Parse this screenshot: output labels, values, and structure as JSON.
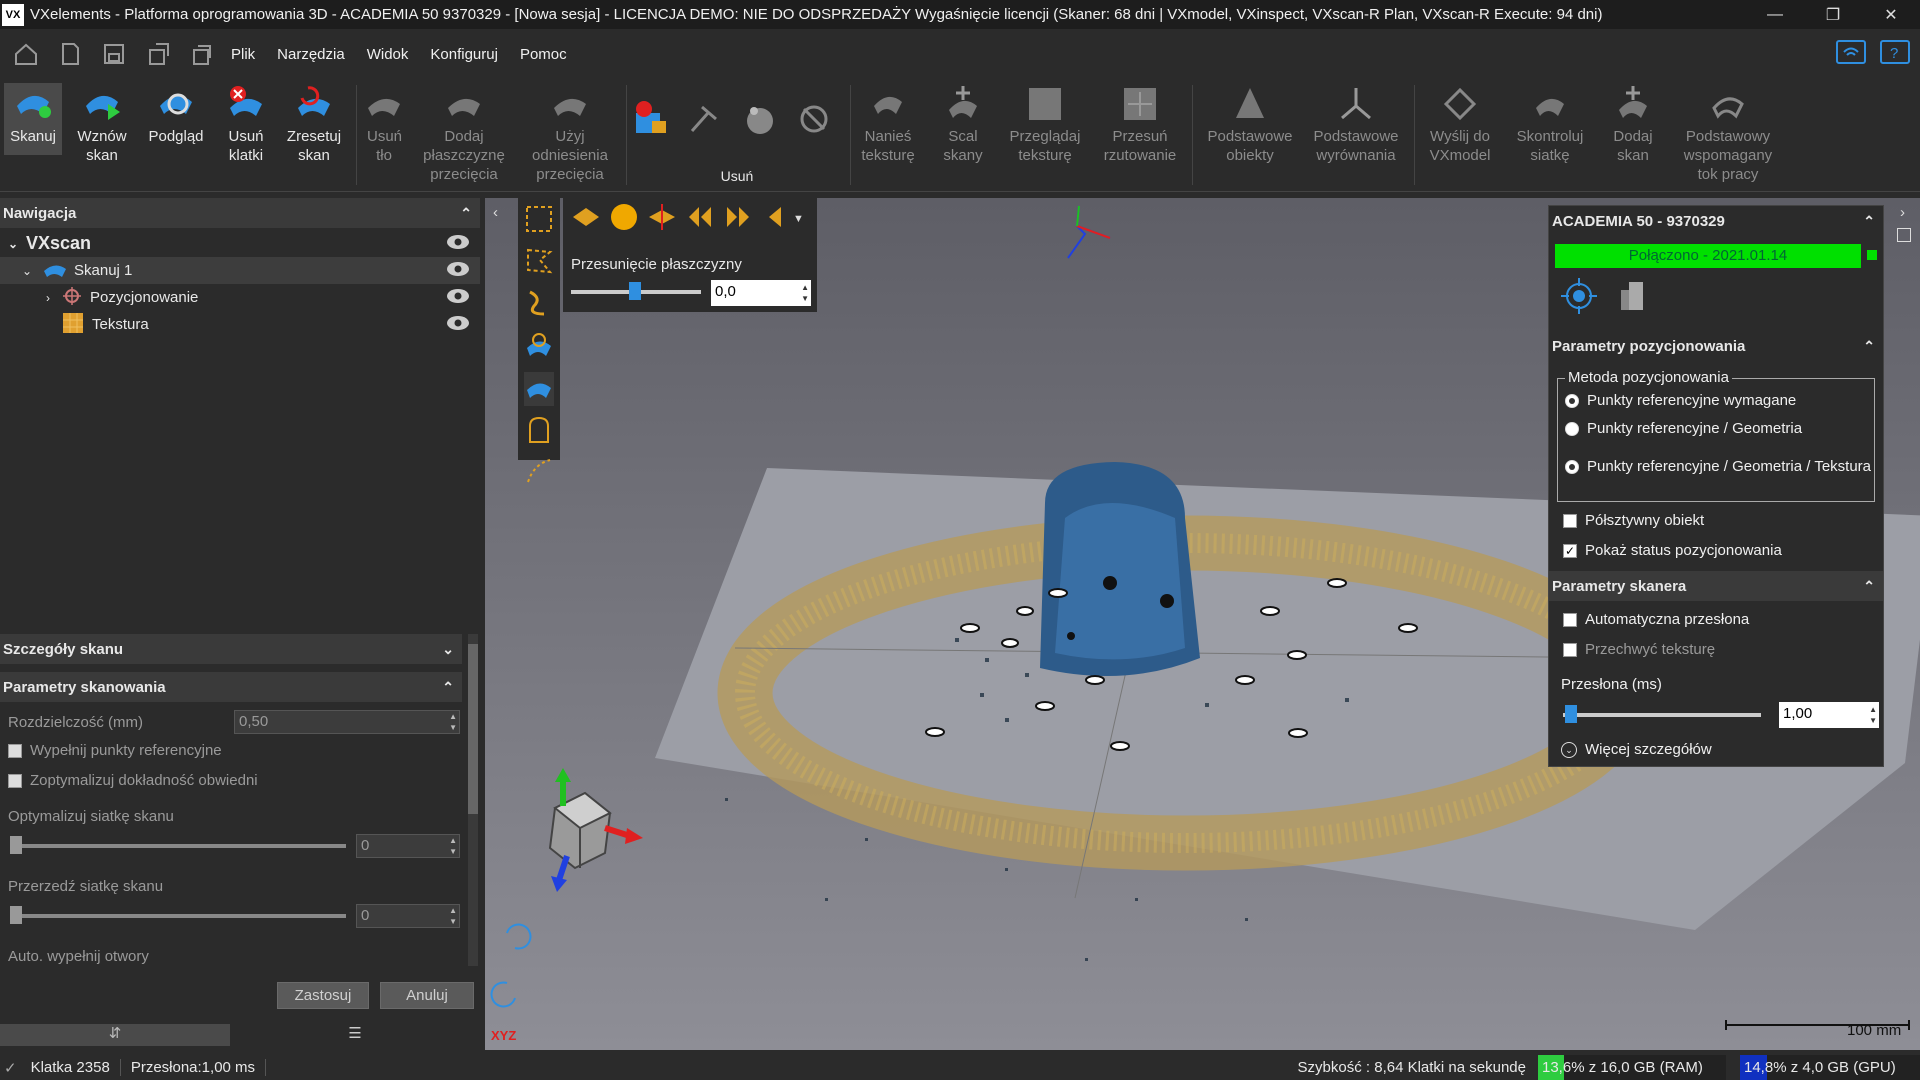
{
  "titlebar": {
    "logo": "VX",
    "title": "VXelements - Platforma oprogramowania 3D - ACADEMIA 50 9370329 - [Nowa sesja] - LICENCJA DEMO: NIE DO ODSPRZEDAŻY Wygaśnięcie licencji (Skaner: 68 dni | VXmodel, VXinspect, VXscan-R Plan, VXscan-R Execute: 94 dni)"
  },
  "menu": {
    "items": [
      "Plik",
      "Narzędzia",
      "Widok",
      "Konfiguruj",
      "Pomoc"
    ]
  },
  "ribbon": {
    "skanuj": "Skanuj",
    "wznow": "Wznów skan",
    "podglad": "Podgląd",
    "usun_klatki": "Usuń klatki",
    "zresetuj": "Zresetuj skan",
    "usun_tlo": "Usuń tło",
    "dodaj_plasz": "Dodaj płaszczyznę przecięcia",
    "uzyj_odn": "Użyj odniesienia przecięcia",
    "group_usun": "Usuń",
    "nanies": "Nanieś teksturę",
    "scal": "Scal skany",
    "przegladaj": "Przeglądaj teksturę",
    "przesun": "Przesuń rzutowanie",
    "podst_obiekty": "Podstawowe obiekty",
    "podst_wyr": "Podstawowe wyrównania",
    "wyslij": "Wyślij do VXmodel",
    "skontroluj": "Skontroluj siatkę",
    "dodaj_skan": "Dodaj skan",
    "podst_wsp": "Podstawowy wspomagany tok pracy"
  },
  "nav": {
    "header": "Nawigacja",
    "root": "VXscan",
    "scan1": "Skanuj 1",
    "pos": "Pozycjonowanie",
    "tex": "Tekstura"
  },
  "details": {
    "header": "Szczegóły skanu",
    "params": "Parametry skanowania",
    "res_label": "Rozdzielczość (mm)",
    "res_value": "0,50",
    "fill_refs": "Wypełnij punkty referencyjne",
    "optimize_env": "Zoptymalizuj dokładność obwiedni",
    "opt_mesh": "Optymalizuj siatkę skanu",
    "opt_val": "0",
    "thin_mesh": "Przerzedź siatkę skanu",
    "thin_val": "0",
    "auto_fill": "Auto. wypełnij otwory",
    "apply": "Zastosuj",
    "cancel": "Anuluj"
  },
  "plane": {
    "label": "Przesunięcie płaszczyzny",
    "value": "0,0"
  },
  "right": {
    "device": "ACADEMIA 50 - 9370329",
    "connected": "Połączono - 2021.01.14",
    "pos_params": "Parametry pozycjonowania",
    "method": "Metoda pozycjonowania",
    "r1": "Punkty referencyjne wymagane",
    "r2": "Punkty referencyjne / Geometria",
    "r3": "Punkty referencyjne / Geometria / Tekstura",
    "half": "Półsztywny obiekt",
    "show_status": "Pokaż status pozycjonowania",
    "scanner_params": "Parametry skanera",
    "auto_shutter": "Automatyczna przesłona",
    "capture_tex": "Przechwyć teksturę",
    "shutter_label": "Przesłona (ms)",
    "shutter_val": "1,00",
    "more": "Więcej szczegółów"
  },
  "viewport": {
    "scale": "100 mm",
    "axes": "XYZ"
  },
  "status": {
    "frame": "Klatka 2358",
    "shutter": "Przesłona:1,00 ms",
    "speed": "Szybkość : 8,64 Klatki na sekundę",
    "ram": "13,6% z 16,0 GB (RAM)",
    "gpu": "14,8% z 4,0 GB (GPU)"
  },
  "colors": {
    "accent": "#1e90ff",
    "connected": "#00e000",
    "ram": "#2ecc40",
    "gpu": "#1030c0"
  }
}
